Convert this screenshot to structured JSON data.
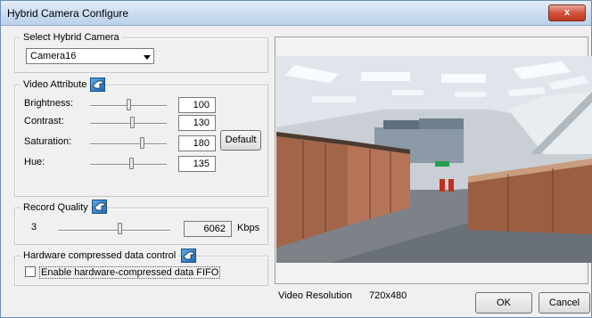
{
  "window": {
    "title": "Hybrid Camera Configure",
    "close_symbol": "x"
  },
  "select_camera": {
    "group_label": "Select Hybrid Camera",
    "selected": "Camera16"
  },
  "video_attribute": {
    "group_label": "Video Attribute",
    "controls": [
      {
        "label": "Brightness:",
        "value": "100",
        "level": 0.5
      },
      {
        "label": "Contrast:",
        "value": "130",
        "level": 0.55
      },
      {
        "label": "Saturation:",
        "value": "180",
        "level": 0.68
      },
      {
        "label": "Hue:",
        "value": "135",
        "level": 0.53
      }
    ],
    "default_button": "Default"
  },
  "record_quality": {
    "group_label": "Record Quality",
    "min_value": "3",
    "value": "6062",
    "unit": "Kbps",
    "level": 0.55
  },
  "hardware": {
    "group_label": "Hardware compressed data control",
    "checkbox_label": "Enable hardware-compressed data FIFO",
    "checked": false
  },
  "video_info": {
    "resolution_label": "Video Resolution",
    "resolution_value": "720x480"
  },
  "buttons": {
    "ok": "OK",
    "cancel": "Cancel"
  }
}
